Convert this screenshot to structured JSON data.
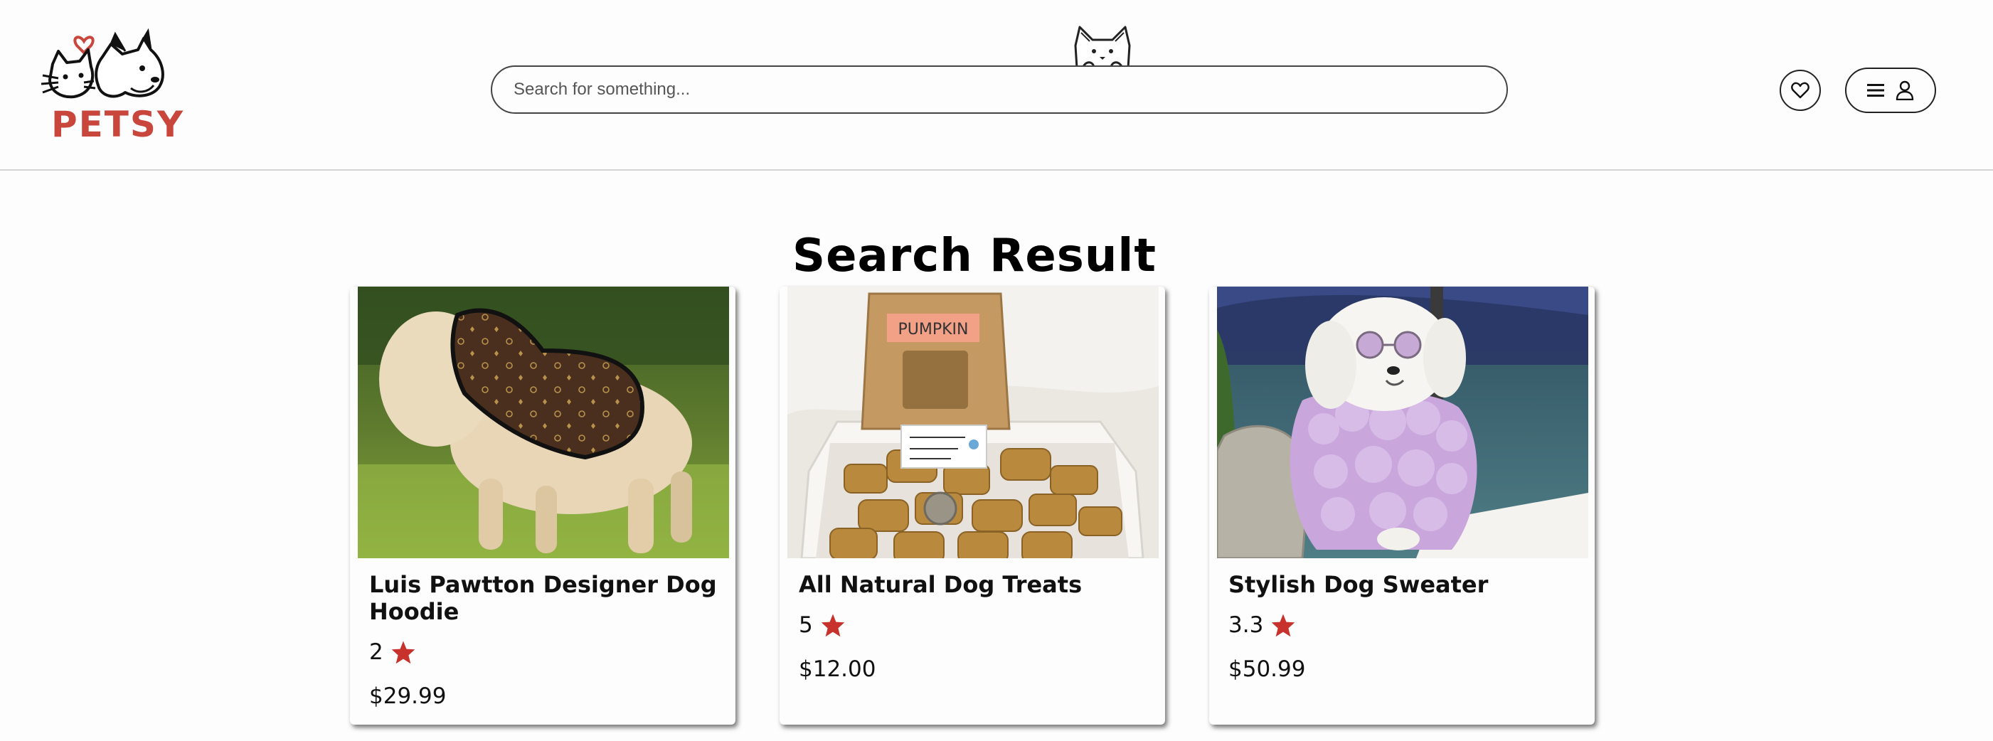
{
  "brand": {
    "name": "PETSY",
    "color": "#c8463c"
  },
  "search": {
    "placeholder": "Search for something...",
    "value": ""
  },
  "header": {
    "favorites_icon": "heart-icon",
    "menu_icon": "hamburger-icon",
    "account_icon": "user-icon"
  },
  "main": {
    "title": "Search Result",
    "products": [
      {
        "name": "Luis Pawtton Designer Dog Hoodie",
        "rating": "2",
        "price": "$29.99",
        "image": "dog-in-brown-designer-hoodie"
      },
      {
        "name": "All Natural Dog Treats",
        "rating": "5",
        "price": "$12.00",
        "image": "pumpkin-dog-treats-bag",
        "image_label": "PUMPKIN"
      },
      {
        "name": "Stylish Dog Sweater",
        "rating": "3.3",
        "price": "$50.99",
        "image": "white-dog-in-lilac-sweater-with-sunglasses"
      }
    ],
    "star_color": "#c8322c"
  }
}
